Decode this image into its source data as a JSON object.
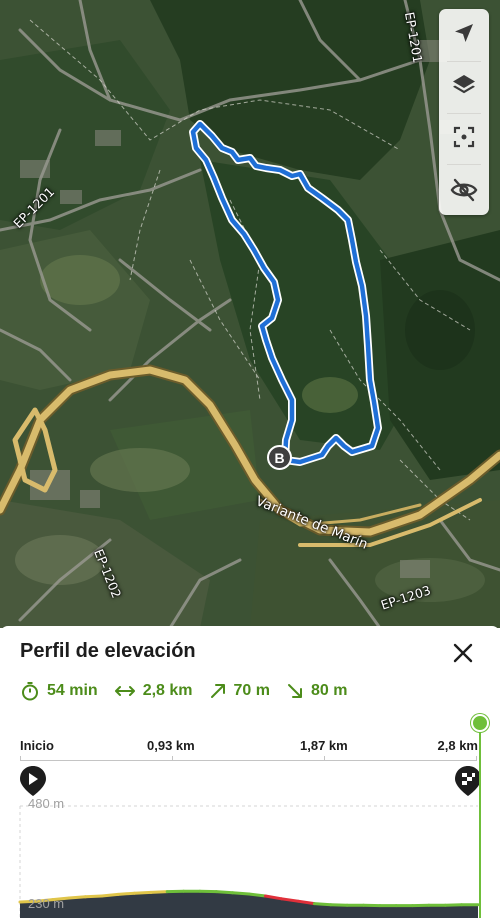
{
  "map": {
    "road_labels": {
      "ep1201_top": "EP-1201",
      "ep1201_left": "EP-1201",
      "ep1202": "EP-1202",
      "ep1203": "EP-1203",
      "variante": "Variante de Marín"
    },
    "marker_label": "B",
    "controls": [
      "navigation-arrow-icon",
      "layers-icon",
      "focus-frame-icon",
      "eye-off-icon"
    ],
    "route_color": "#1f6fd6"
  },
  "panel": {
    "title": "Perfil de elevación",
    "close_icon": "close-icon",
    "stats": {
      "duration": "54 min",
      "distance": "2,8 km",
      "ascent": "70 m",
      "descent": "80 m"
    },
    "scale": {
      "labels": [
        "Inicio",
        "0,93 km",
        "1,87 km",
        "2,8 km"
      ]
    },
    "y_axis": {
      "top": "480 m",
      "bottom": "230 m"
    },
    "accent_color": "#6fbf3a"
  },
  "chart_data": {
    "type": "area",
    "title": "Perfil de elevación",
    "xlabel": "",
    "ylabel": "",
    "x_ticks": [
      "Inicio",
      "0,93 km",
      "1,87 km",
      "2,8 km"
    ],
    "y_ticks": [
      "480 m",
      "230 m"
    ],
    "xlim": [
      0,
      2.8
    ],
    "ylim": [
      230,
      480
    ],
    "x": [
      0,
      0.1,
      0.2,
      0.3,
      0.4,
      0.5,
      0.6,
      0.7,
      0.8,
      0.9,
      1.0,
      1.1,
      1.2,
      1.3,
      1.4,
      1.5,
      1.6,
      1.7,
      1.8,
      1.9,
      2.0,
      2.1,
      2.2,
      2.3,
      2.4,
      2.5,
      2.6,
      2.7,
      2.8
    ],
    "y": [
      250,
      252,
      256,
      260,
      263,
      265,
      269,
      272,
      274,
      276,
      277,
      277,
      276,
      273,
      270,
      265,
      258,
      252,
      246,
      243,
      242,
      242,
      241,
      241,
      241,
      242,
      242,
      243,
      243
    ],
    "segment_colors": {
      "gentle_up": "#e0c54a",
      "flat": "#6fbf3a",
      "steep_down": "#e0303a"
    }
  }
}
